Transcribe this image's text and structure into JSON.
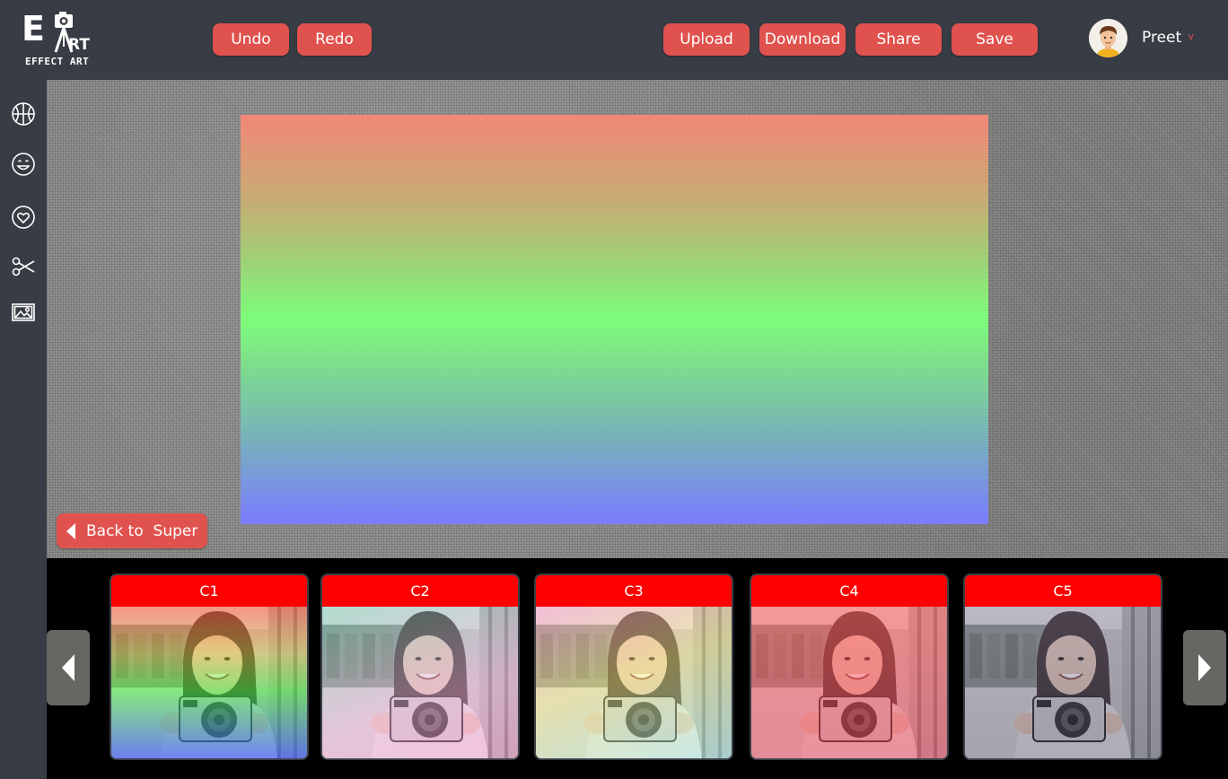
{
  "logo": {
    "main": "E",
    "art": "RT",
    "subtitle": "EFFECT ART"
  },
  "toolbar": {
    "undo": "Undo",
    "redo": "Redo",
    "upload": "Upload",
    "download": "Download",
    "share": "Share",
    "save": "Save"
  },
  "user": {
    "name": "Preet",
    "caret": "v"
  },
  "sidebar": {
    "items": [
      {
        "icon": "basketball-icon"
      },
      {
        "icon": "smiley-icon"
      },
      {
        "icon": "heart-icon"
      },
      {
        "icon": "scissors-icon"
      },
      {
        "icon": "image-icon"
      }
    ]
  },
  "editor": {
    "back_label": "Back to  Super"
  },
  "filters": {
    "items": [
      {
        "label": "C1",
        "tint": "linear-gradient(180deg, rgba(255,80,60,0.55) 0%, rgba(220,200,60,0.45) 30%, rgba(60,240,60,0.55) 55%, rgba(60,80,255,0.7) 100%)"
      },
      {
        "label": "C2",
        "tint": "linear-gradient(160deg, rgba(80,200,170,0.35) 0%, rgba(240,170,220,0.45) 60%, rgba(255,120,200,0.35) 100%)"
      },
      {
        "label": "C3",
        "tint": "linear-gradient(160deg, rgba(255,140,200,0.45) 0%, rgba(240,230,120,0.45) 45%, rgba(150,230,240,0.45) 100%)"
      },
      {
        "label": "C4",
        "tint": "linear-gradient(180deg, rgba(255,90,90,0.55) 0%, rgba(230,60,90,0.5) 100%)"
      },
      {
        "label": "C5",
        "tint": "linear-gradient(180deg, rgba(110,100,140,0.35) 0%, rgba(60,60,90,0.35) 100%)"
      }
    ]
  },
  "colors": {
    "accent": "#e0524e",
    "background": "#383c44",
    "thumb_header": "#ff0000"
  }
}
